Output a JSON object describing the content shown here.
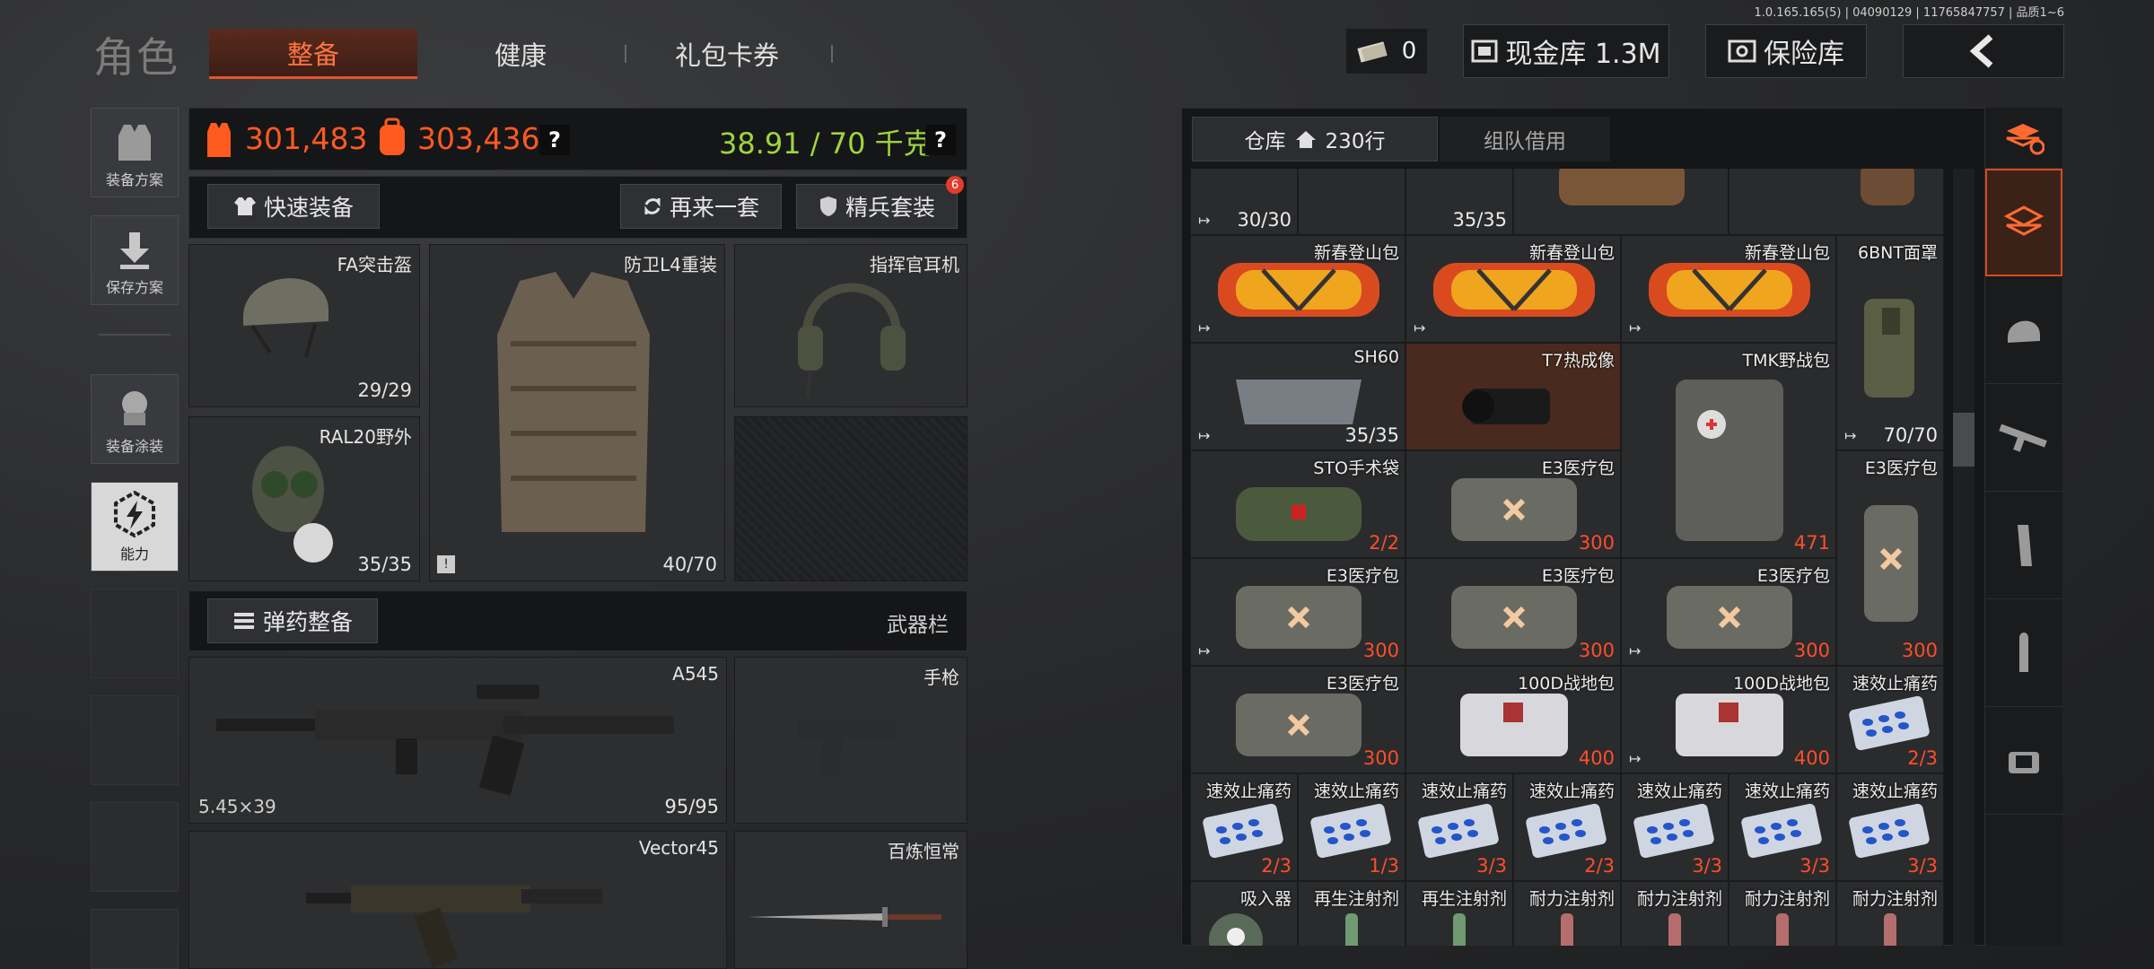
{
  "version_text": "1.0.165.165(5) | 04090129 | 11765847757 | 品质1~6",
  "title": "角色",
  "tabs": [
    "整备",
    "健康",
    "礼包卡券"
  ],
  "header": {
    "money_count": "0",
    "cash_vault": "现金库 1.3M",
    "safe": "保险库",
    "back_icon": "chevron-left-icon"
  },
  "sidebar": [
    {
      "label": "装备方案",
      "icon": "vest-icon"
    },
    {
      "label": "保存方案",
      "icon": "download-icon"
    },
    {
      "label": "装备涂装",
      "icon": "paint-icon"
    },
    {
      "label": "能力",
      "icon": "lightning-hex-icon"
    }
  ],
  "stats": {
    "value1": "301,483",
    "value2": "303,436",
    "weight": "38.91 / 70 千克",
    "help": "?"
  },
  "actions": {
    "quick": "快速装备",
    "again": "再来一套",
    "elite": "精兵套装",
    "elite_badge": "6"
  },
  "gear": {
    "helmet": {
      "name": "FA突击盔",
      "count": "29/29"
    },
    "armor": {
      "name": "防卫L4重装",
      "count": "40/70"
    },
    "headset": {
      "name": "指挥官耳机"
    },
    "mask": {
      "name": "RAL20野外",
      "count": "35/35"
    }
  },
  "ammo": {
    "label": "弹药整备",
    "weapon_bar": "武器栏"
  },
  "weapons": {
    "primary": {
      "name": "A545",
      "caliber": "5.45×39",
      "count": "95/95"
    },
    "pistol": {
      "name": "手枪"
    },
    "secondary": {
      "name": "Vector45"
    },
    "melee": {
      "name": "百炼恒常"
    }
  },
  "storage": {
    "tab_warehouse": "仓库",
    "rows": "230行",
    "tab_team": "组队借用"
  },
  "grid": [
    [
      "",
      "30/30",
      "",
      "35/35",
      "",
      "",
      "",
      ""
    ],
    [
      "新春登山包",
      "新春登山包",
      "新春登山包",
      "6BNT面罩"
    ],
    [
      "SH60",
      "35/35",
      "T7热成像",
      "TMK野战包",
      "6BNT面罩",
      "70/70"
    ],
    [
      "STO手术袋",
      "2/2",
      "E3医疗包",
      "300",
      "471",
      "E3医疗包"
    ],
    [
      "E3医疗包",
      "300",
      "E3医疗包",
      "300",
      "E3医疗包",
      "300",
      "300"
    ],
    [
      "E3医疗包",
      "300",
      "100D战地包",
      "400",
      "100D战地包",
      "400",
      "速效止痛药",
      "2/3"
    ],
    [
      "速效止痛药",
      "2/3",
      "速效止痛药",
      "1/3",
      "速效止痛药",
      "3/3",
      "速效止痛药",
      "2/3",
      "速效止痛药",
      "3/3",
      "速效止痛药",
      "3/3",
      "速效止痛药",
      "3/3"
    ],
    [
      "吸入器",
      "再生注射剂",
      "再生注射剂",
      "耐力注射剂",
      "耐力注射剂",
      "耐力注射剂",
      "耐力注射剂"
    ]
  ],
  "colors": {
    "accent": "#ff7440",
    "orange": "#ff5a1f",
    "green": "#9fd53b",
    "red": "#ff4d2a"
  }
}
